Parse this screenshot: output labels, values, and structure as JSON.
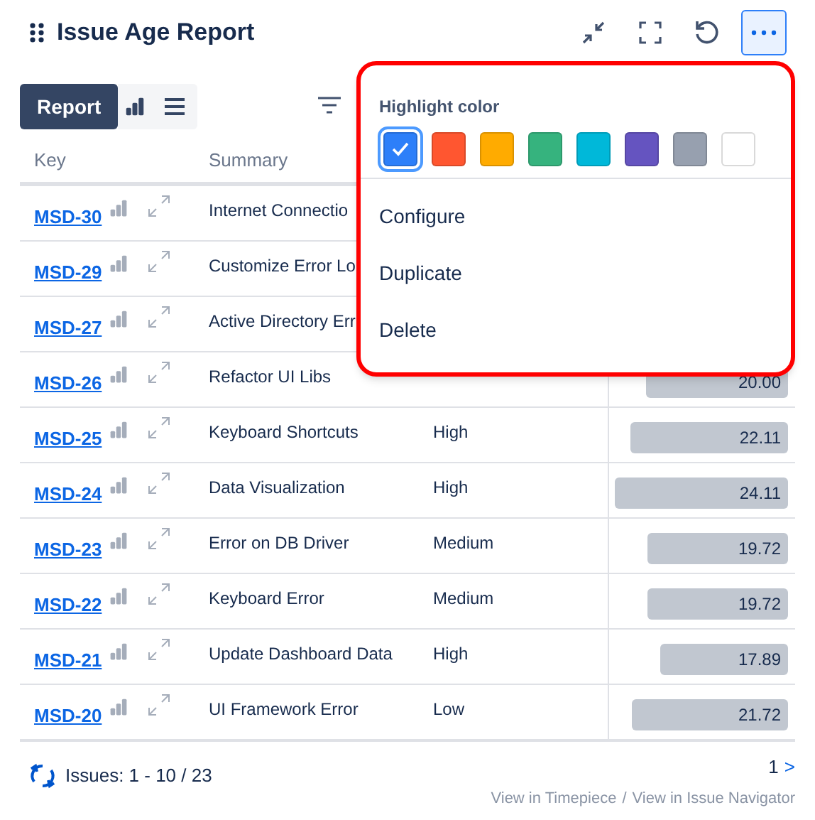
{
  "title": "Issue Age Report",
  "toolbar": {
    "report_button": "Report",
    "chart_view_selected": false,
    "list_view_selected": false
  },
  "table": {
    "columns": [
      "Key",
      "Summary"
    ],
    "rows": [
      {
        "key": "MSD-30",
        "summary": "Internet Connectio"
      },
      {
        "key": "MSD-29",
        "summary": "Customize Error Lo"
      },
      {
        "key": "MSD-27",
        "summary": "Active Directory Err"
      },
      {
        "key": "MSD-26",
        "summary": "Refactor UI Libs",
        "age": "20.00",
        "level": 0.82
      },
      {
        "key": "MSD-25",
        "summary": "Keyboard Shortcuts",
        "priority": "High",
        "age": "22.11",
        "level": 0.91
      },
      {
        "key": "MSD-24",
        "summary": "Data Visualization",
        "priority": "High",
        "age": "24.11",
        "level": 1.0
      },
      {
        "key": "MSD-23",
        "summary": "Error on DB Driver",
        "priority": "Medium",
        "age": "19.72",
        "level": 0.81
      },
      {
        "key": "MSD-22",
        "summary": "Keyboard Error",
        "priority": "Medium",
        "age": "19.72",
        "level": 0.81
      },
      {
        "key": "MSD-21",
        "summary": "Update Dashboard Data",
        "priority": "High",
        "age": "17.89",
        "level": 0.74
      },
      {
        "key": "MSD-20",
        "summary": "UI Framework Error",
        "priority": "Low",
        "age": "21.72",
        "level": 0.9
      }
    ]
  },
  "footer": {
    "issues": "Issues: 1 - 10 / 23",
    "page": "1",
    "next": ">",
    "link_timepiece": "View in Timepiece",
    "separator": "/",
    "link_navigator": "View in Issue Navigator"
  },
  "menu": {
    "heading": "Highlight color",
    "colors": [
      {
        "color": "#2d7ff9",
        "selected": true
      },
      {
        "color": "#ff5630",
        "selected": false
      },
      {
        "color": "#ffab00",
        "selected": false
      },
      {
        "color": "#36b37e",
        "selected": false
      },
      {
        "color": "#00b8d9",
        "selected": false
      },
      {
        "color": "#6554c0",
        "selected": false
      },
      {
        "color": "#97a0af",
        "selected": false
      },
      {
        "color": "#ffffff",
        "selected": false
      }
    ],
    "items": [
      "Configure",
      "Duplicate",
      "Delete"
    ]
  }
}
